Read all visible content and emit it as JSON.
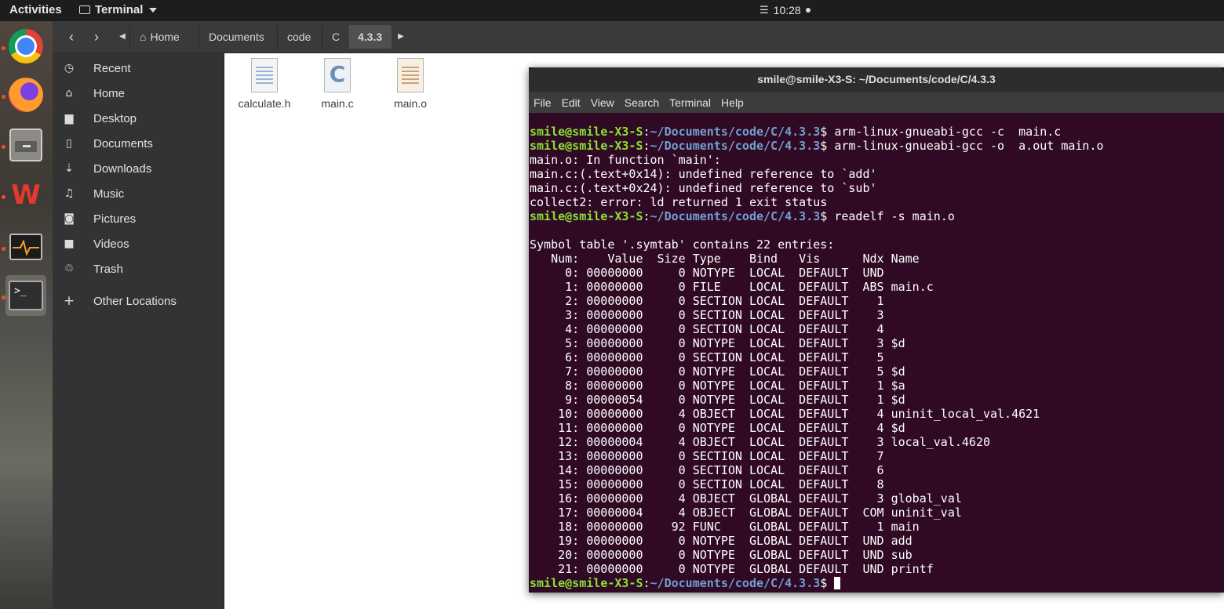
{
  "topbar": {
    "activities": "Activities",
    "app_name": "Terminal",
    "clock": "10:28"
  },
  "dock": [
    {
      "name": "chrome",
      "running": true,
      "active": false
    },
    {
      "name": "firefox",
      "running": true,
      "active": false
    },
    {
      "name": "files",
      "running": true,
      "active": false
    },
    {
      "name": "wps-office",
      "running": true,
      "active": false
    },
    {
      "name": "system-monitor",
      "running": true,
      "active": false
    },
    {
      "name": "terminal",
      "running": true,
      "active": true
    }
  ],
  "breadcrumb": {
    "back_icon": "chevron-left-icon",
    "forward_icon": "chevron-right-icon",
    "items": [
      "Home",
      "Documents",
      "code",
      "C",
      "4.3.3"
    ]
  },
  "sidebar": {
    "items": [
      {
        "label": "Recent",
        "icon": "clock-icon"
      },
      {
        "label": "Home",
        "icon": "home-icon"
      },
      {
        "label": "Desktop",
        "icon": "folder-icon"
      },
      {
        "label": "Documents",
        "icon": "document-icon"
      },
      {
        "label": "Downloads",
        "icon": "download-icon"
      },
      {
        "label": "Music",
        "icon": "music-icon"
      },
      {
        "label": "Pictures",
        "icon": "camera-icon"
      },
      {
        "label": "Videos",
        "icon": "video-icon"
      },
      {
        "label": "Trash",
        "icon": "trash-icon"
      },
      {
        "label": "Other Locations",
        "icon": "plus-icon"
      }
    ]
  },
  "files": [
    {
      "name": "calculate.h",
      "icon": "text-file-icon"
    },
    {
      "name": "main.c",
      "icon": "c-source-file-icon"
    },
    {
      "name": "main.o",
      "icon": "object-file-icon"
    }
  ],
  "terminal": {
    "title": "smile@smile-X3-S: ~/Documents/code/C/4.3.3",
    "menu": [
      "File",
      "Edit",
      "View",
      "Search",
      "Terminal",
      "Help"
    ],
    "prompt_user": "smile@smile-X3-S",
    "prompt_path": "~/Documents/code/C/4.3.3",
    "lines": [
      {
        "prompt": true,
        "text": " arm-linux-gnueabi-gcc -c  main.c"
      },
      {
        "prompt": true,
        "text": " arm-linux-gnueabi-gcc -o  a.out main.o"
      },
      {
        "prompt": false,
        "text": "main.o: In function `main':"
      },
      {
        "prompt": false,
        "text": "main.c:(.text+0x14): undefined reference to `add'"
      },
      {
        "prompt": false,
        "text": "main.c:(.text+0x24): undefined reference to `sub'"
      },
      {
        "prompt": false,
        "text": "collect2: error: ld returned 1 exit status"
      },
      {
        "prompt": true,
        "text": " readelf -s main.o"
      },
      {
        "prompt": false,
        "text": ""
      },
      {
        "prompt": false,
        "text": "Symbol table '.symtab' contains 22 entries:"
      },
      {
        "prompt": false,
        "text": "   Num:    Value  Size Type    Bind   Vis      Ndx Name"
      },
      {
        "prompt": false,
        "text": "     0: 00000000     0 NOTYPE  LOCAL  DEFAULT  UND "
      },
      {
        "prompt": false,
        "text": "     1: 00000000     0 FILE    LOCAL  DEFAULT  ABS main.c"
      },
      {
        "prompt": false,
        "text": "     2: 00000000     0 SECTION LOCAL  DEFAULT    1 "
      },
      {
        "prompt": false,
        "text": "     3: 00000000     0 SECTION LOCAL  DEFAULT    3 "
      },
      {
        "prompt": false,
        "text": "     4: 00000000     0 SECTION LOCAL  DEFAULT    4 "
      },
      {
        "prompt": false,
        "text": "     5: 00000000     0 NOTYPE  LOCAL  DEFAULT    3 $d"
      },
      {
        "prompt": false,
        "text": "     6: 00000000     0 SECTION LOCAL  DEFAULT    5 "
      },
      {
        "prompt": false,
        "text": "     7: 00000000     0 NOTYPE  LOCAL  DEFAULT    5 $d"
      },
      {
        "prompt": false,
        "text": "     8: 00000000     0 NOTYPE  LOCAL  DEFAULT    1 $a"
      },
      {
        "prompt": false,
        "text": "     9: 00000054     0 NOTYPE  LOCAL  DEFAULT    1 $d"
      },
      {
        "prompt": false,
        "text": "    10: 00000000     4 OBJECT  LOCAL  DEFAULT    4 uninit_local_val.4621"
      },
      {
        "prompt": false,
        "text": "    11: 00000000     0 NOTYPE  LOCAL  DEFAULT    4 $d"
      },
      {
        "prompt": false,
        "text": "    12: 00000004     4 OBJECT  LOCAL  DEFAULT    3 local_val.4620"
      },
      {
        "prompt": false,
        "text": "    13: 00000000     0 SECTION LOCAL  DEFAULT    7 "
      },
      {
        "prompt": false,
        "text": "    14: 00000000     0 SECTION LOCAL  DEFAULT    6 "
      },
      {
        "prompt": false,
        "text": "    15: 00000000     0 SECTION LOCAL  DEFAULT    8 "
      },
      {
        "prompt": false,
        "text": "    16: 00000000     4 OBJECT  GLOBAL DEFAULT    3 global_val"
      },
      {
        "prompt": false,
        "text": "    17: 00000004     4 OBJECT  GLOBAL DEFAULT  COM uninit_val"
      },
      {
        "prompt": false,
        "text": "    18: 00000000    92 FUNC    GLOBAL DEFAULT    1 main"
      },
      {
        "prompt": false,
        "text": "    19: 00000000     0 NOTYPE  GLOBAL DEFAULT  UND add"
      },
      {
        "prompt": false,
        "text": "    20: 00000000     0 NOTYPE  GLOBAL DEFAULT  UND sub"
      },
      {
        "prompt": false,
        "text": "    21: 00000000     0 NOTYPE  GLOBAL DEFAULT  UND printf"
      },
      {
        "prompt": true,
        "text": " ",
        "cursor": true
      }
    ]
  },
  "colors": {
    "terminal_bg": "#300a24",
    "prompt_user": "#8ae234",
    "prompt_path": "#729fcf",
    "running_dot": "#e95420"
  }
}
